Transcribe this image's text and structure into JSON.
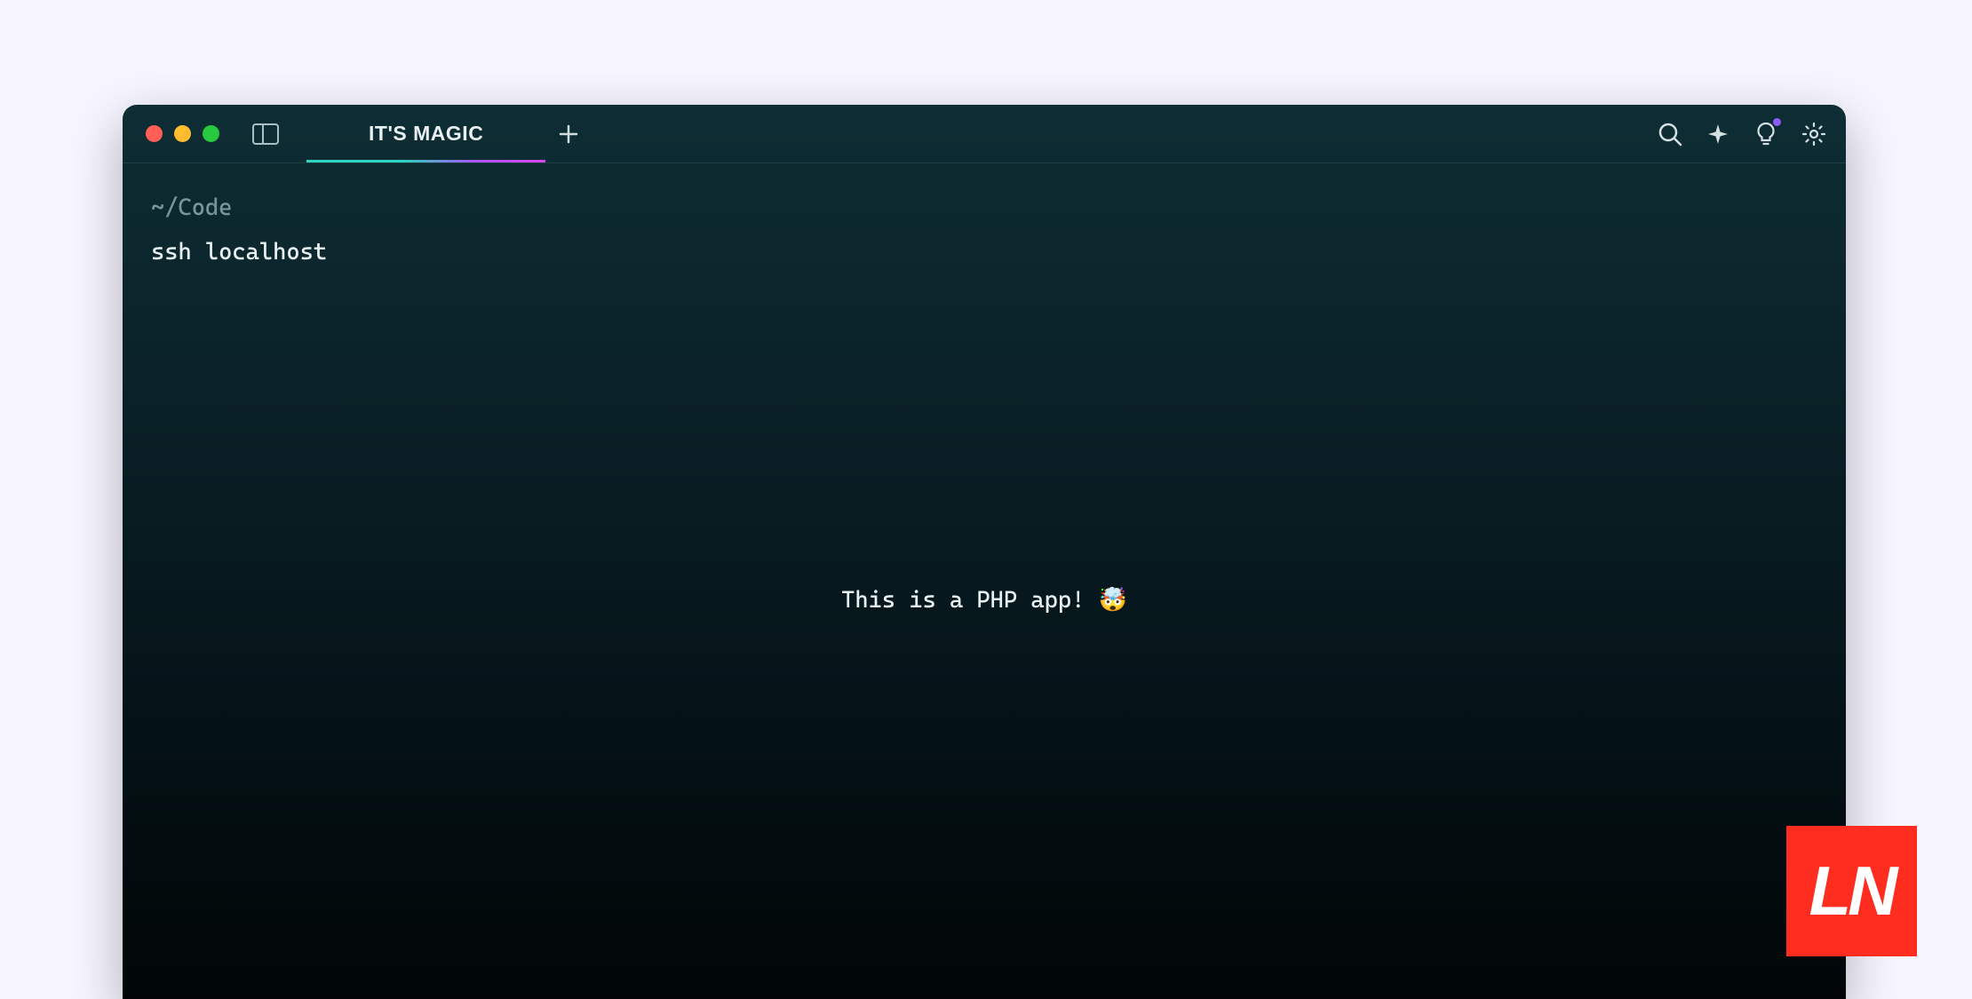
{
  "tab": {
    "title": "IT'S MAGIC"
  },
  "terminal": {
    "prompt_path": "~/Code",
    "command": "ssh localhost",
    "center_message": "This is a PHP app! 🤯"
  },
  "logo": {
    "text": "LN"
  },
  "icons": {
    "panel": "panel-icon",
    "new_tab": "plus-icon",
    "search": "search-icon",
    "sparkle": "sparkle-icon",
    "bulb": "bulb-icon",
    "gear": "gear-icon"
  }
}
